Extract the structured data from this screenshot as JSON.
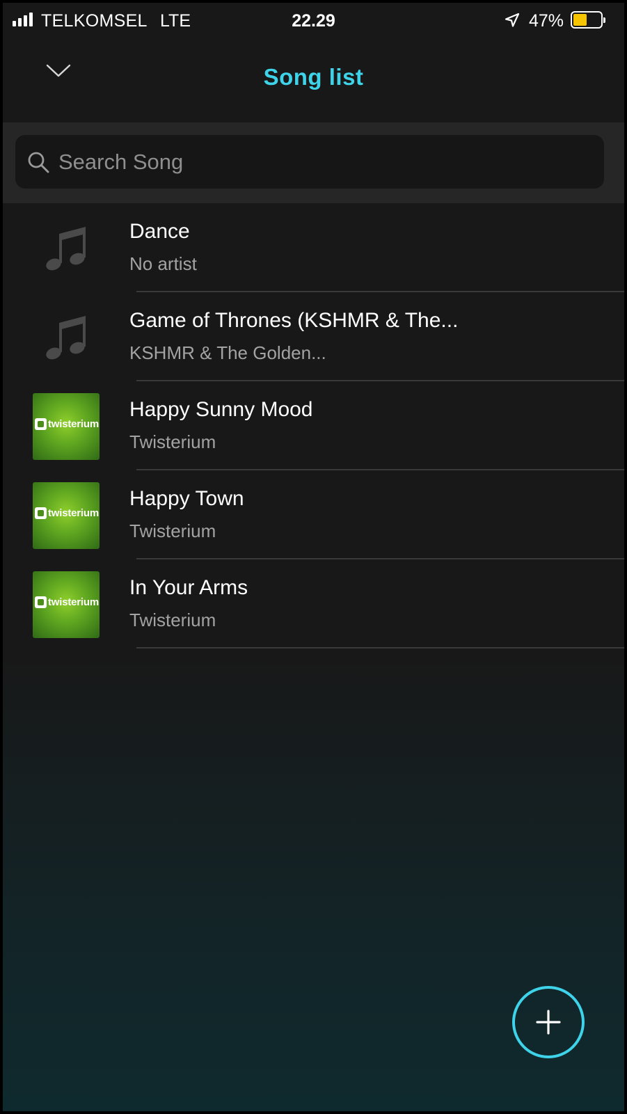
{
  "status_bar": {
    "carrier": "TELKOMSEL",
    "network": "LTE",
    "time": "22.29",
    "battery_percent": "47%",
    "battery_level": 0.47,
    "battery_color": "#f6c400",
    "icons": [
      "signal-icon",
      "location-arrow-icon",
      "battery-icon"
    ]
  },
  "header": {
    "title": "Song list",
    "back_icon": "chevron-down-icon",
    "accent_color": "#3fd3ea"
  },
  "search": {
    "placeholder": "Search Song",
    "value": "",
    "icon": "search-icon"
  },
  "songs": [
    {
      "title": "Dance",
      "artist": "No artist",
      "artwork": "music-note-icon"
    },
    {
      "title": "Game of Thrones (KSHMR & The...",
      "artist": "KSHMR & The Golden...",
      "artwork": "music-note-icon"
    },
    {
      "title": "Happy Sunny Mood",
      "artist": "Twisterium",
      "artwork": "album-cover",
      "cover_text": "twisterium"
    },
    {
      "title": "Happy Town",
      "artist": "Twisterium",
      "artwork": "album-cover",
      "cover_text": "twisterium"
    },
    {
      "title": "In Your Arms",
      "artist": "Twisterium",
      "artwork": "album-cover",
      "cover_text": "twisterium"
    }
  ],
  "fab": {
    "icon": "plus-icon"
  }
}
